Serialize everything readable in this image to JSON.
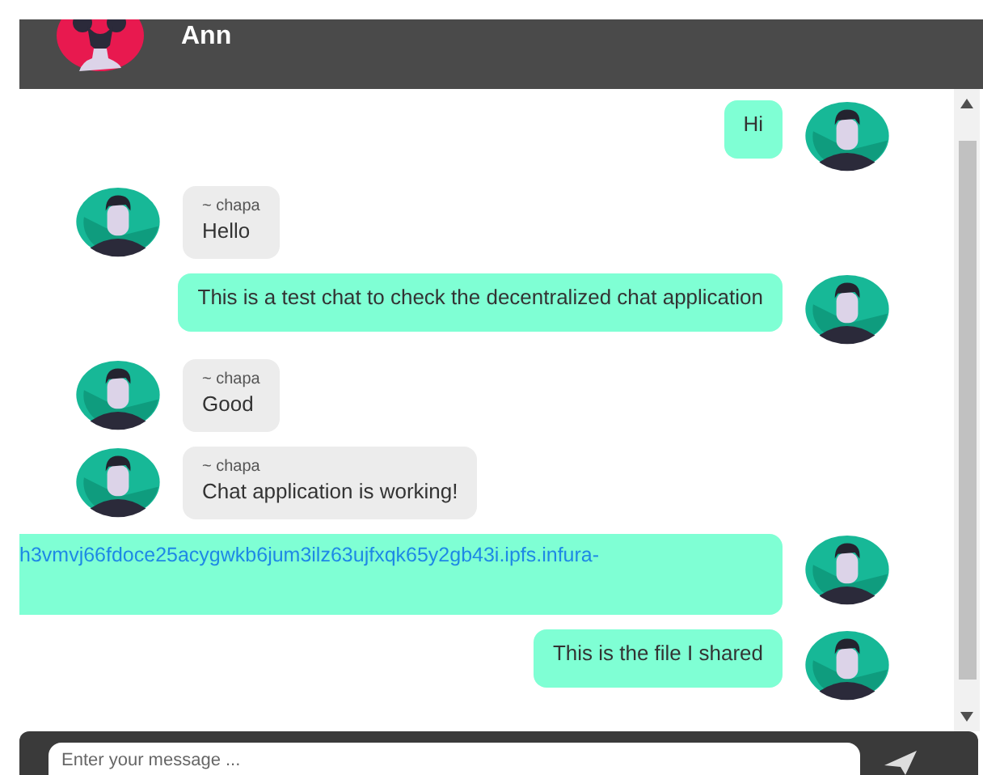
{
  "header": {
    "name": "Ann"
  },
  "messages": [
    {
      "kind": "sent",
      "text": "Hi"
    },
    {
      "kind": "received",
      "sender": "~ chapa",
      "text": "Hello"
    },
    {
      "kind": "sent",
      "text": "This is a test chat to check the decentralized chat application"
    },
    {
      "kind": "received",
      "sender": "~ chapa",
      "text": "Good"
    },
    {
      "kind": "received",
      "sender": "~ chapa",
      "text": "Chat application is working!"
    },
    {
      "kind": "link",
      "text": "h3vmvj66fdoce25acygwkb6jum3ilz63ujfxqk65y2gb43i.ipfs.infura-"
    },
    {
      "kind": "sent",
      "text": "This is the file I shared"
    }
  ],
  "composer": {
    "placeholder": "Enter your message ..."
  }
}
